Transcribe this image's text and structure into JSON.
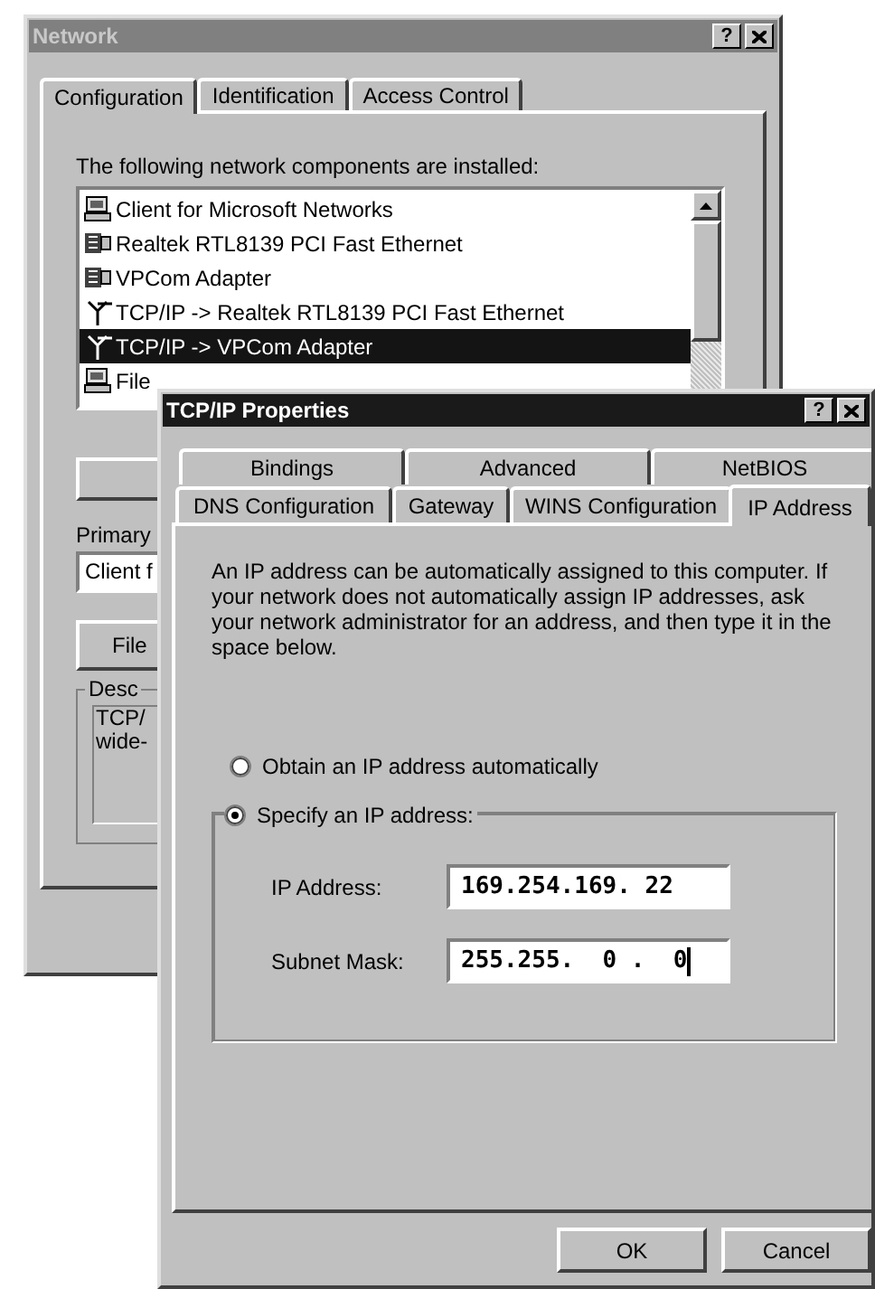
{
  "network_window": {
    "title": "Network",
    "help_button": "?",
    "active": false,
    "tabs": [
      {
        "label": "Configuration",
        "selected": true
      },
      {
        "label": "Identification",
        "selected": false
      },
      {
        "label": "Access Control",
        "selected": false
      }
    ],
    "list_label": "The following network components are installed:",
    "components": [
      {
        "label": "Client for Microsoft Networks",
        "kind": "client",
        "selected": false
      },
      {
        "label": "Realtek RTL8139 PCI Fast Ethernet",
        "kind": "adapter",
        "selected": false
      },
      {
        "label": "VPCom Adapter",
        "kind": "adapter",
        "selected": false
      },
      {
        "label": "TCP/IP -> Realtek RTL8139 PCI Fast Ethernet",
        "kind": "protocol",
        "selected": false
      },
      {
        "label": "TCP/IP -> VPCom Adapter",
        "kind": "protocol",
        "selected": true
      },
      {
        "label": "File",
        "kind": "client",
        "selected": false
      }
    ],
    "primary_label": "Primary",
    "primary_value": "Client f",
    "file_button": "File",
    "description_label": "Desc",
    "description_lines": [
      "TCP/",
      "wide-"
    ]
  },
  "tcpip_window": {
    "title": "TCP/IP Properties",
    "help_button": "?",
    "active": true,
    "tab_rows": [
      [
        {
          "label": "Bindings",
          "selected": false
        },
        {
          "label": "Advanced",
          "selected": false
        },
        {
          "label": "NetBIOS",
          "selected": false
        }
      ],
      [
        {
          "label": "DNS Configuration",
          "selected": false
        },
        {
          "label": "Gateway",
          "selected": false
        },
        {
          "label": "WINS Configuration",
          "selected": false
        },
        {
          "label": "IP Address",
          "selected": true
        }
      ]
    ],
    "intro": "An IP address can be automatically assigned to this computer. If your network does not automatically assign IP addresses, ask your network administrator for an address, and then type it in the space below.",
    "options": [
      {
        "label": "Obtain an IP address automatically",
        "selected": false
      },
      {
        "label": "Specify an IP address:",
        "selected": true
      }
    ],
    "fields": [
      {
        "label": "IP Address:",
        "value": "169.254.169. 22",
        "focused": false
      },
      {
        "label": "Subnet Mask:",
        "value": "255.255.  0 .  0",
        "focused": true
      }
    ],
    "buttons": [
      "OK",
      "Cancel"
    ]
  }
}
